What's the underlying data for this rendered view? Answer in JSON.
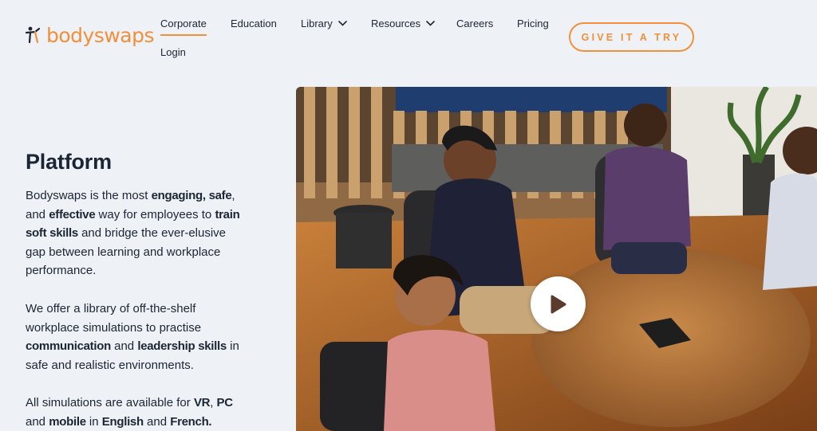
{
  "brand": {
    "name": "bodyswaps",
    "accent": "#f0903a"
  },
  "nav": {
    "corporate": "Corporate",
    "education": "Education",
    "library": "Library",
    "resources": "Resources",
    "careers": "Careers",
    "pricing": "Pricing",
    "login": "Login",
    "cta": "GIVE IT A TRY",
    "active": "Corporate"
  },
  "main": {
    "heading": "Platform",
    "p1": [
      "Bodyswaps is the most ",
      "engaging",
      ",",
      " safe",
      ", and ",
      "effective",
      " way for employees to ",
      "train soft skills",
      " and bridge the ever-elusive gap between learning and workplace performance."
    ],
    "p2": [
      "We offer a library of off-the-shelf workplace simulations to practise ",
      "communication",
      " and ",
      "leadership skills",
      " in safe and realistic environments."
    ],
    "p3": [
      "All simulations are available for ",
      "VR",
      ", ",
      "PC",
      " and ",
      "mobile",
      " in ",
      "English",
      " and ",
      "French."
    ]
  },
  "media": {
    "video_thumbnail": "virtual-meeting-room-scene",
    "play_icon": "play-icon"
  }
}
